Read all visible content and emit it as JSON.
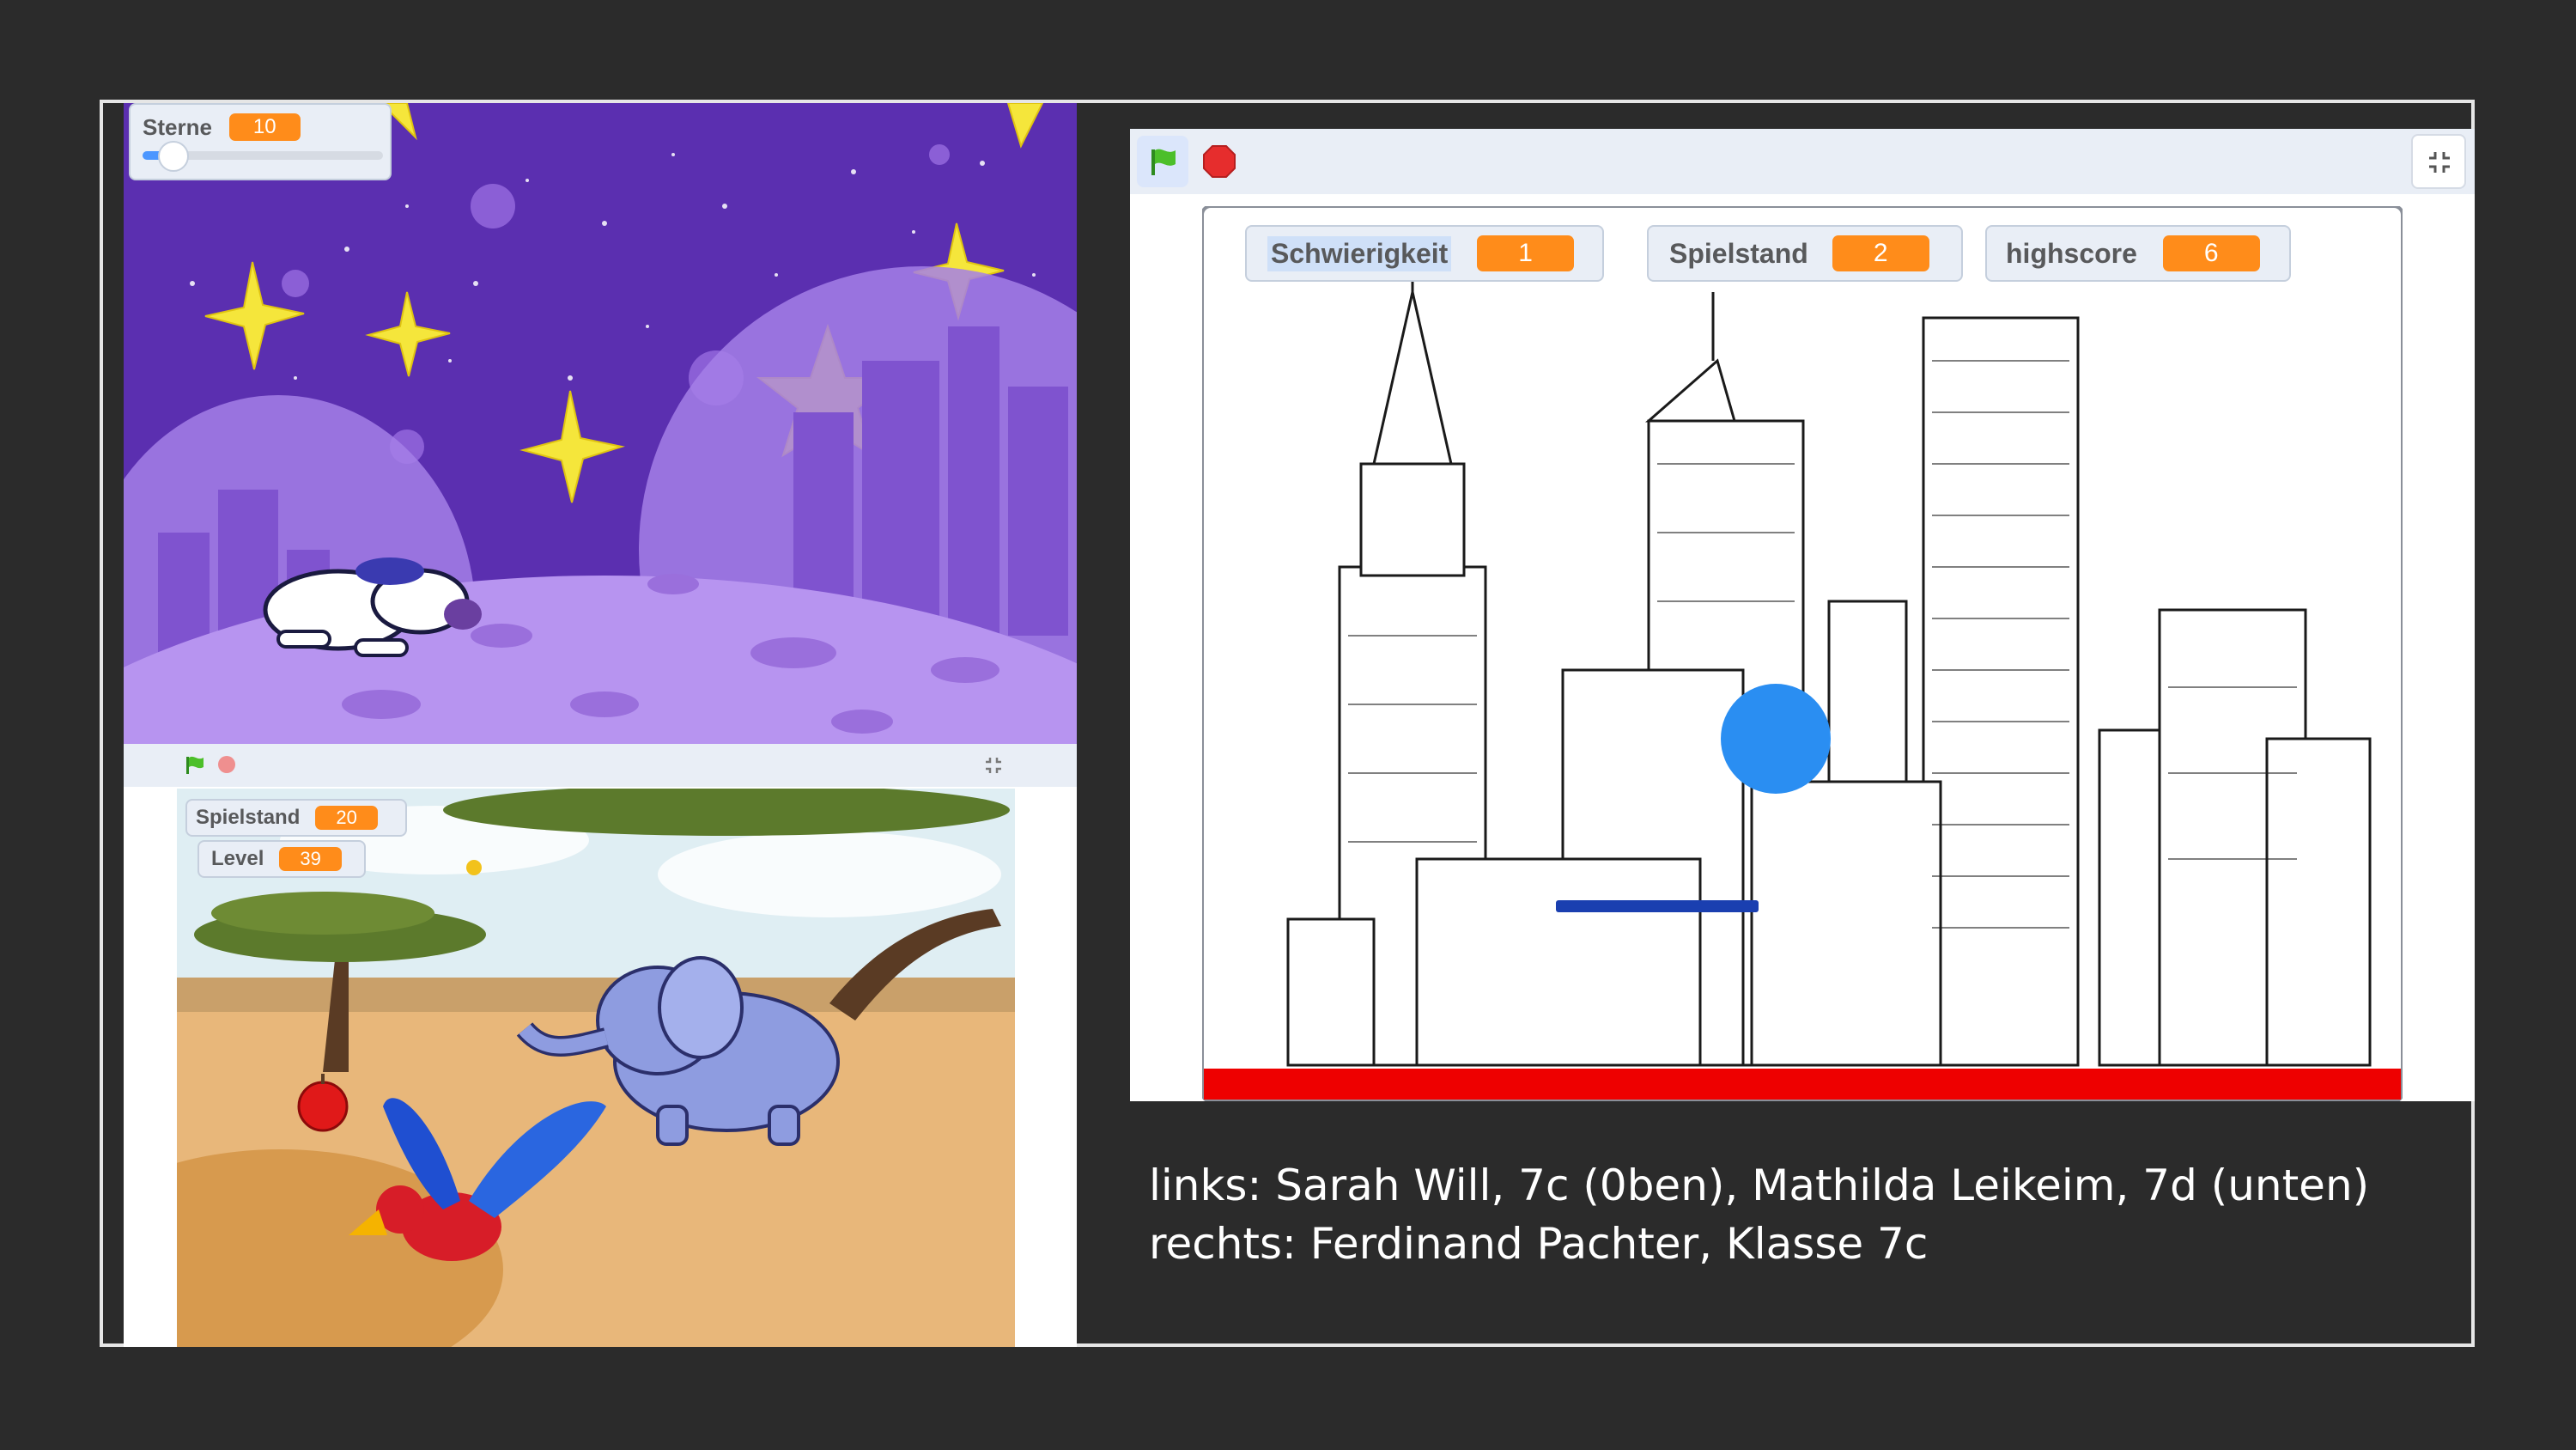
{
  "colors": {
    "background": "#2b2b2b",
    "monitor_value": "#ff8c1a",
    "ground": "#ee0000",
    "ball": "#2a8ef2",
    "platform": "#1a3fb0"
  },
  "project_top_left": {
    "monitor": {
      "label": "Sterne",
      "value": "10"
    },
    "slider": {
      "value_fraction": 0.1
    }
  },
  "project_bottom_left": {
    "toolbar": {
      "flag_icon": "green-flag-icon",
      "stop_icon": "stop-icon",
      "fullscreen_icon": "exit-fullscreen-icon"
    },
    "monitors": [
      {
        "label": "Spielstand",
        "value": "20"
      },
      {
        "label": "Level",
        "value": "39"
      }
    ]
  },
  "project_right": {
    "toolbar": {
      "flag_icon": "green-flag-icon",
      "stop_icon": "stop-icon",
      "fullscreen_icon": "exit-fullscreen-icon"
    },
    "monitors": [
      {
        "label": "Schwierigkeit",
        "value": "1"
      },
      {
        "label": "Spielstand",
        "value": "2"
      },
      {
        "label": "highscore",
        "value": "6"
      }
    ]
  },
  "caption": {
    "line1": "links: Sarah Will, 7c (0ben), Mathilda Leikeim, 7d (unten)",
    "line2": "rechts: Ferdinand Pachter, Klasse 7c"
  }
}
